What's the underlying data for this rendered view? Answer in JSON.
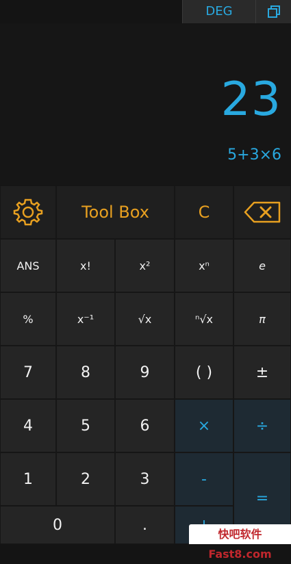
{
  "header": {
    "angle_mode": "DEG"
  },
  "display": {
    "result": "23",
    "expression": "5+3×6"
  },
  "row0": {
    "toolbox": "Tool Box",
    "clear": "C"
  },
  "rows": {
    "r1": [
      "ANS",
      "x!",
      "x²",
      "xⁿ",
      "e"
    ],
    "r2": [
      "%",
      "x⁻¹",
      "√x",
      "ⁿ√x",
      "π"
    ],
    "r3": [
      "7",
      "8",
      "9",
      "( )",
      "±"
    ],
    "r4": [
      "4",
      "5",
      "6",
      "×",
      "÷"
    ],
    "r5": [
      "1",
      "2",
      "3",
      "-"
    ],
    "r6": [
      "0",
      ".",
      "+"
    ],
    "equals": "="
  },
  "watermark": "快吧软件 Fast8.com",
  "colors": {
    "accent": "#29a9e0",
    "highlight": "#e8a020",
    "background": "#141414"
  },
  "icons": [
    "copy-icon",
    "settings-gear-icon",
    "backspace-icon"
  ]
}
